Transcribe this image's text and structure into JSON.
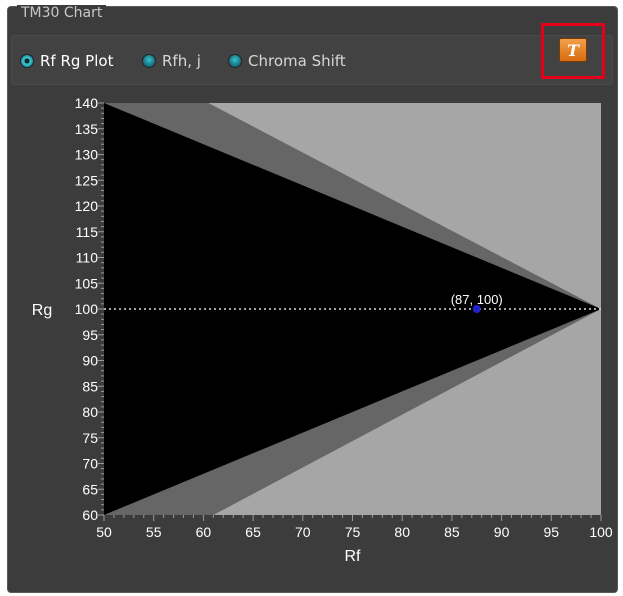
{
  "panel": {
    "title": "TM30 Chart"
  },
  "toolbar": {
    "options": [
      {
        "label": "Rf Rg Plot",
        "checked": true
      },
      {
        "label": "Rfh, j",
        "checked": false
      },
      {
        "label": "Chroma Shift",
        "checked": false
      }
    ],
    "t_button_icon": "text-t-icon",
    "t_button_glyph": "T",
    "highlight_color": "#e4001b"
  },
  "chart_data": {
    "type": "scatter",
    "title": "",
    "xlabel": "Rf",
    "ylabel": "Rg",
    "xlim": [
      50,
      100
    ],
    "ylim": [
      60,
      140
    ],
    "x_ticks": [
      50,
      55,
      60,
      65,
      70,
      75,
      80,
      85,
      90,
      95,
      100
    ],
    "y_ticks": [
      140,
      135,
      130,
      125,
      120,
      115,
      110,
      105,
      100,
      95,
      90,
      85,
      80,
      75,
      70,
      65,
      60
    ],
    "series": [
      {
        "x": [
          87.5
        ],
        "y": [
          100
        ],
        "color": "#2222cc"
      }
    ],
    "point_label": "(87, 100)",
    "reference_line": {
      "y": 100,
      "style": "dotted"
    },
    "regions": {
      "outer_color": "#a6a6a6",
      "middle_color": "#666666",
      "inner_color": "#000000",
      "middle_boundary": {
        "apex": [
          100,
          100
        ],
        "upper_at_50": 140,
        "upper_top_x": 60.5,
        "lower_at_50": 60,
        "lower_bottom_x": 61
      },
      "inner_boundary": {
        "apex": [
          100,
          100
        ],
        "upper_at_50": 140,
        "lower_at_50": 60
      }
    },
    "grid": false,
    "legend": "none"
  }
}
